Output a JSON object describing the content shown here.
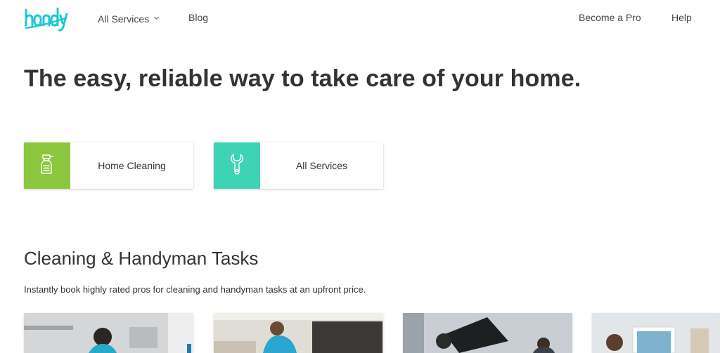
{
  "header": {
    "logo_text": "handy",
    "nav": {
      "all_services": "All Services",
      "blog": "Blog",
      "become_pro": "Become a Pro",
      "help": "Help"
    }
  },
  "hero": {
    "title": "The easy, reliable way to take care of your home."
  },
  "service_cards": [
    {
      "label": "Home Cleaning",
      "icon": "spray-bottle-icon",
      "color": "#8cc63f"
    },
    {
      "label": "All Services",
      "icon": "wrench-icon",
      "color": "#3fd3b6"
    }
  ],
  "tasks_section": {
    "title": "Cleaning & Handyman Tasks",
    "subtitle": "Instantly book highly rated pros for cleaning and handyman tasks at an upfront price."
  },
  "brand_color": "#1ec8d8"
}
